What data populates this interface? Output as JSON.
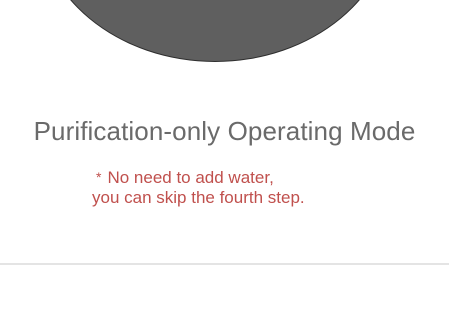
{
  "mode": {
    "title": "Purification-only Operating Mode"
  },
  "note": {
    "marker": "*",
    "line1": "No need to add water,",
    "line2": "you can skip the fourth step."
  },
  "colors": {
    "title": "#6a6a6a",
    "note": "#c0504d",
    "device": "#5f5f5f",
    "divider": "#e4e4e4"
  }
}
